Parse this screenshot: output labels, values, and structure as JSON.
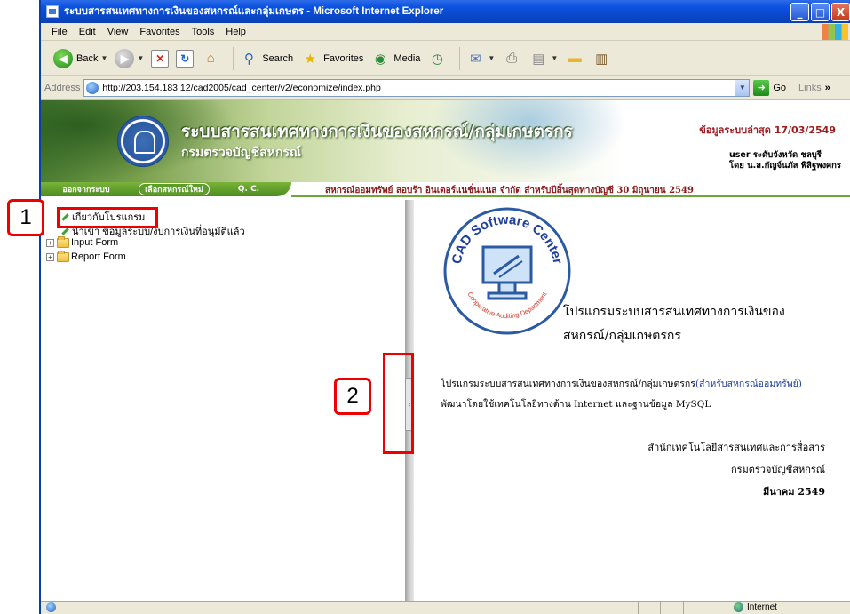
{
  "window": {
    "title": "ระบบสารสนเทศทางการเงินของสหกรณ์และกลุ่มเกษตร - Microsoft Internet Explorer",
    "controls": [
      "_",
      "□",
      "X"
    ]
  },
  "menu": [
    "File",
    "Edit",
    "View",
    "Favorites",
    "Tools",
    "Help"
  ],
  "toolbar": {
    "back": "Back",
    "search": "Search",
    "favorites": "Favorites",
    "media": "Media"
  },
  "address": {
    "label": "Address",
    "url": "http://203.154.183.12/cad2005/cad_center/v2/economize/index.php",
    "go": "Go",
    "links": "Links",
    "links_chevron": "»"
  },
  "banner": {
    "title": "ระบบสารสนเทศทางการเงินของสหกรณ์/กลุ่มเกษตรกร",
    "subtitle": "กรมตรวจบัญชีสหกรณ์",
    "updated": "ข้อมูลระบบล่าสุด 17/03/2549",
    "user_line1": "user ระดับจังหวัด ชลบุรี",
    "user_line2": "โดย น.ส.กัญจ์นภัส พิสิฐพงศกร"
  },
  "nav": {
    "tabs": [
      "ออกจากระบบ",
      "เลือกสหกรณ์ใหม่",
      "Q. C."
    ],
    "coop_info": "สหกรณ์ออมทรัพย์ ลอบร้า อินเตอร์แนชั่นแนล จำกัด สำหรับปีสิ้นสุดทางบัญชี 30 มิถุนายน 2549"
  },
  "tree": {
    "items": [
      {
        "label": "เกี่ยวกับโปรแกรม",
        "type": "link"
      },
      {
        "label": "นำเข้า ข้อมูลระบบ/งบการเงินที่อนุมัติแล้ว",
        "type": "link"
      },
      {
        "label": "Input Form",
        "type": "folder"
      },
      {
        "label": "Report Form",
        "type": "folder"
      }
    ]
  },
  "content": {
    "logo_text_top": "CAD Software Center",
    "logo_text_bottom": "Cooperative Auditing Department",
    "program_title_1": "โปรแกรมระบบสารสนเทศทางการเงินของ",
    "program_title_2": "สหกรณ์/กลุ่มเกษตรกร",
    "desc_prefix": "โปรแกรมระบบสารสนเทศทางการเงินของสหกรณ์/กลุ่มเกษตรกร",
    "desc_highlight": "(สำหรับสหกรณ์ออมทรัพย์)",
    "desc_suffix": " พัฒนาโดยใช้เทคโนโลยีทางด้าน Internet และฐานข้อมูล MySQL",
    "org_1": "สำนักเทคโนโลยีสารสนเทศและการสื่อสาร",
    "org_2": "กรมตรวจบัญชีสหกรณ์",
    "org_3": "มีนาคม 2549"
  },
  "status": {
    "zone": "Internet"
  },
  "annotations": {
    "callout_1": "1",
    "callout_2": "2"
  },
  "colors": {
    "xp_title": "#0B52DF",
    "highlight_red": "#EE0000",
    "nav_green": "#5d9c2b",
    "coop_text": "#8a1a1a"
  }
}
